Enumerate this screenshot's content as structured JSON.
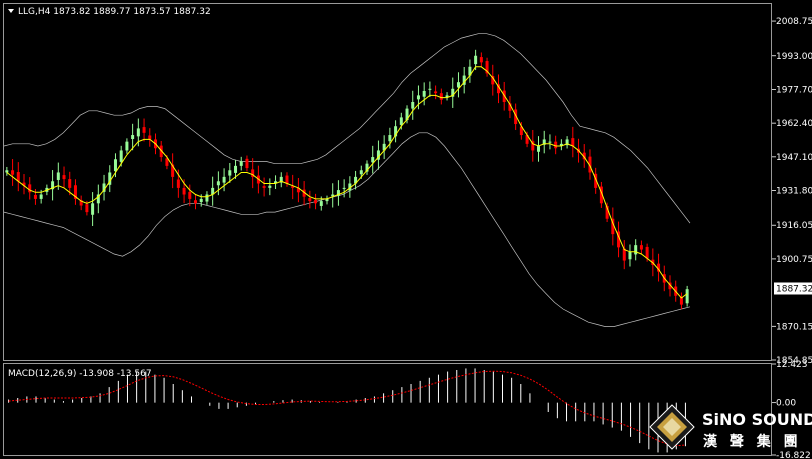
{
  "header": {
    "symbol_line": "LLG,H4  1873.82 1889.77 1873.57 1887.32",
    "indicator_line": "MACD(12,26,9) -13.908 -13.567"
  },
  "colors": {
    "background": "#000000",
    "bull_candle": "#98fb98",
    "bear_candle": "#ff0000",
    "ma_line": "#ffff00",
    "bollinger": "#c0c0c0",
    "macd_hist": "#ffffff",
    "macd_signal": "#ff0000",
    "grid": "#ffffff",
    "price_box_bg": "#ffffff",
    "price_box_text": "#000000"
  },
  "logo": {
    "name": "SiNO SOUND",
    "chinese": "漢 聲 集 團",
    "icon": "diamond-logo-icon"
  },
  "chart_data": [
    {
      "type": "candlestick",
      "title": "LLG,H4",
      "ohlc_last": {
        "open": 1873.82,
        "high": 1889.77,
        "low": 1873.57,
        "close": 1887.32
      },
      "ylim": [
        1854.85,
        2016.5
      ],
      "y_ticks": [
        "2008.75",
        "1993.00",
        "1977.70",
        "1962.40",
        "1947.10",
        "1931.80",
        "1916.05",
        "1900.75",
        "1870.15",
        "1854.85"
      ],
      "current_price_label": "1887.32",
      "current_price": 1887.32,
      "close_series": [
        1941,
        1939,
        1936,
        1934,
        1931,
        1928,
        1930,
        1933,
        1936,
        1940,
        1937,
        1933,
        1928,
        1925,
        1922,
        1926,
        1930,
        1935,
        1940,
        1946,
        1950,
        1954,
        1957,
        1960,
        1958,
        1955,
        1951,
        1947,
        1943,
        1938,
        1933,
        1930,
        1928,
        1926,
        1928,
        1930,
        1933,
        1936,
        1938,
        1941,
        1943,
        1945,
        1942,
        1938,
        1935,
        1933,
        1934,
        1936,
        1938,
        1935,
        1933,
        1931,
        1929,
        1927,
        1926,
        1927,
        1928,
        1930,
        1932,
        1933,
        1935,
        1938,
        1941,
        1944,
        1947,
        1950,
        1953,
        1957,
        1961,
        1965,
        1969,
        1972,
        1975,
        1977,
        1978,
        1976,
        1973,
        1975,
        1978,
        1981,
        1984,
        1988,
        1993,
        1990,
        1985,
        1980,
        1976,
        1972,
        1968,
        1962,
        1957,
        1953,
        1950,
        1952,
        1955,
        1954,
        1951,
        1953,
        1955,
        1952,
        1949,
        1946,
        1940,
        1933,
        1926,
        1919,
        1912,
        1906,
        1900,
        1904,
        1907,
        1905,
        1901,
        1898,
        1895,
        1890,
        1887,
        1884,
        1880,
        1887
      ],
      "ma_series": [
        1940,
        1938,
        1936,
        1934,
        1932,
        1931,
        1931,
        1932,
        1933,
        1934,
        1933,
        1931,
        1929,
        1927,
        1926,
        1927,
        1929,
        1932,
        1936,
        1940,
        1944,
        1948,
        1951,
        1954,
        1955,
        1955,
        1953,
        1950,
        1947,
        1943,
        1939,
        1935,
        1932,
        1930,
        1929,
        1929,
        1930,
        1932,
        1934,
        1936,
        1938,
        1940,
        1940,
        1939,
        1937,
        1935,
        1935,
        1935,
        1936,
        1935,
        1934,
        1933,
        1931,
        1929,
        1928,
        1928,
        1928,
        1929,
        1930,
        1931,
        1933,
        1935,
        1938,
        1941,
        1944,
        1947,
        1950,
        1953,
        1957,
        1961,
        1964,
        1968,
        1971,
        1973,
        1975,
        1975,
        1974,
        1974,
        1975,
        1978,
        1981,
        1984,
        1988,
        1988,
        1986,
        1983,
        1979,
        1975,
        1971,
        1966,
        1961,
        1957,
        1953,
        1952,
        1953,
        1953,
        1952,
        1952,
        1953,
        1952,
        1950,
        1947,
        1943,
        1937,
        1931,
        1924,
        1917,
        1911,
        1905,
        1904,
        1904,
        1903,
        1901,
        1899,
        1896,
        1892,
        1889,
        1886,
        1883,
        1885
      ],
      "bb_upper": [
        1952,
        1953,
        1953,
        1953,
        1952,
        1953,
        1955,
        1958,
        1962,
        1966,
        1968,
        1968,
        1967,
        1966,
        1966,
        1967,
        1969,
        1970,
        1970,
        1969,
        1966,
        1963,
        1960,
        1957,
        1954,
        1951,
        1948,
        1946,
        1945,
        1945,
        1945,
        1945,
        1944,
        1944,
        1944,
        1944,
        1945,
        1946,
        1948,
        1951,
        1954,
        1957,
        1960,
        1964,
        1968,
        1972,
        1976,
        1981,
        1985,
        1988,
        1991,
        1994,
        1997,
        1999,
        2001,
        2002,
        2003,
        2003,
        2002,
        2000,
        1997,
        1994,
        1990,
        1986,
        1982,
        1977,
        1972,
        1966,
        1961,
        1960,
        1959,
        1958,
        1956,
        1953,
        1950,
        1946,
        1942,
        1937,
        1932,
        1927,
        1922,
        1917
      ],
      "bb_lower": [
        1922,
        1921,
        1920,
        1919,
        1918,
        1917,
        1916,
        1915,
        1913,
        1911,
        1909,
        1907,
        1905,
        1903,
        1902,
        1904,
        1907,
        1911,
        1916,
        1920,
        1923,
        1925,
        1926,
        1926,
        1925,
        1924,
        1923,
        1922,
        1921,
        1921,
        1921,
        1922,
        1922,
        1923,
        1924,
        1925,
        1926,
        1927,
        1928,
        1929,
        1930,
        1932,
        1934,
        1937,
        1941,
        1945,
        1949,
        1953,
        1956,
        1958,
        1958,
        1956,
        1952,
        1947,
        1942,
        1936,
        1930,
        1924,
        1918,
        1912,
        1906,
        1900,
        1894,
        1889,
        1885,
        1881,
        1878,
        1876,
        1874,
        1872,
        1871,
        1870,
        1870,
        1871,
        1872,
        1873,
        1874,
        1875,
        1876,
        1877,
        1878,
        1879
      ]
    },
    {
      "type": "bar",
      "title": "MACD(12,26,9)",
      "macd": -13.908,
      "signal": -13.567,
      "ylim": [
        -16.822,
        12.423
      ],
      "y_ticks": [
        "12.423",
        "0.00",
        "-16.822"
      ],
      "histogram": [
        1,
        1.5,
        2,
        2,
        1.5,
        1,
        0.5,
        1,
        1.5,
        2,
        3,
        5,
        7,
        9,
        10,
        10,
        9,
        8,
        6,
        4,
        2,
        0,
        -1,
        -2,
        -2,
        -1.5,
        -1,
        -0.5,
        0,
        0.5,
        0.8,
        1,
        0.8,
        0.5,
        0.2,
        0,
        0.2,
        0.5,
        1,
        1.5,
        2,
        3,
        4,
        5,
        6,
        7,
        8,
        9,
        10,
        10.5,
        11,
        11,
        10.5,
        10,
        9,
        8,
        6,
        3,
        0,
        -3,
        -5,
        -6,
        -6,
        -6,
        -6,
        -7,
        -8,
        -9,
        -11,
        -13,
        -15,
        -16,
        -16,
        -15,
        -14
      ],
      "signal_series": [
        0.5,
        0.8,
        1,
        1.3,
        1.5,
        1.5,
        1.5,
        1.5,
        1.6,
        1.8,
        2.2,
        3,
        4.2,
        5.5,
        7,
        8,
        8.6,
        8.7,
        8.3,
        7.4,
        6.2,
        4.8,
        3.4,
        2.1,
        1,
        0.2,
        -0.3,
        -0.6,
        -0.6,
        -0.4,
        -0.1,
        0.2,
        0.4,
        0.5,
        0.4,
        0.3,
        0.3,
        0.4,
        0.6,
        0.9,
        1.3,
        1.8,
        2.4,
        3.1,
        3.9,
        4.8,
        5.7,
        6.6,
        7.5,
        8.3,
        9,
        9.6,
        10,
        10.1,
        10,
        9.6,
        8.8,
        7.6,
        6,
        4,
        1.8,
        -0.3,
        -2,
        -3.3,
        -4.3,
        -5.1,
        -5.9,
        -6.8,
        -7.9,
        -9.2,
        -10.7,
        -12.2,
        -13.3,
        -13.8,
        -13.6
      ]
    }
  ]
}
